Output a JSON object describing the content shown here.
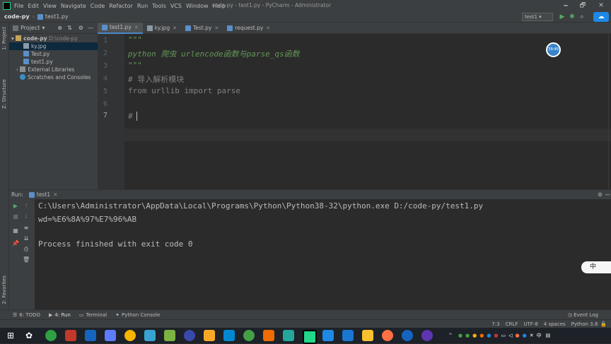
{
  "window": {
    "title": "code-py - test1.py - PyCharm - Administrator",
    "menu": [
      "File",
      "Edit",
      "View",
      "Navigate",
      "Code",
      "Refactor",
      "Run",
      "Tools",
      "VCS",
      "Window",
      "Help"
    ],
    "controls": [
      "🗕",
      "🗗",
      "✕"
    ]
  },
  "navbar": {
    "project": "code-py",
    "file": "test1.py",
    "run_config": "test1"
  },
  "project_panel": {
    "title": "Project",
    "strip_labels": [
      "1: Project",
      "Z: Structure",
      "2: Favorites"
    ],
    "tree": [
      {
        "label": "code-py",
        "path": "D:\\code-py",
        "kind": "folder",
        "indent": 0
      },
      {
        "label": "ky.jpg",
        "kind": "image",
        "indent": 2,
        "selected": true
      },
      {
        "label": "Test.py",
        "kind": "py",
        "indent": 2
      },
      {
        "label": "test1.py",
        "kind": "py",
        "indent": 2
      },
      {
        "label": "External Libraries",
        "kind": "lib",
        "indent": 1
      },
      {
        "label": "Scratches and Consoles",
        "kind": "scratch",
        "indent": 1
      }
    ]
  },
  "editor": {
    "tabs": [
      {
        "label": "test1.py",
        "active": true
      },
      {
        "label": "ky.jpg",
        "active": false
      },
      {
        "label": "Test.py",
        "active": false
      },
      {
        "label": "request.py",
        "active": false
      }
    ],
    "lines": [
      {
        "num": "1",
        "text": "\"\"\""
      },
      {
        "num": "2",
        "text": "python 爬虫 urlencode函数与parse_qs函数"
      },
      {
        "num": "3",
        "text": "\"\"\""
      },
      {
        "num": "4",
        "text": "# 导入解析模块"
      },
      {
        "num": "5",
        "text": "from urllib import parse"
      },
      {
        "num": "6",
        "text": ""
      },
      {
        "num": "7",
        "text": "# "
      }
    ],
    "avatar_text": "39:40"
  },
  "run_panel": {
    "label": "Run:",
    "tab": "test1",
    "output": [
      "C:\\Users\\Administrator\\AppData\\Local\\Programs\\Python\\Python38-32\\python.exe D:/code-py/test1.py",
      "wd=%E6%8A%97%E7%96%AB",
      "",
      "Process finished with exit code 0"
    ]
  },
  "tool_windows": [
    "6: TODO",
    "4: Run",
    "Terminal",
    "Python Console"
  ],
  "event_log": "Event Log",
  "status": {
    "position": "7:3",
    "line_sep": "CRLF",
    "encoding": "UTF-8",
    "indent": "4 spaces",
    "interpreter": "Python 3.8"
  },
  "ime": "中",
  "colors": {
    "keyword": "#cc7832",
    "docstring": "#629755",
    "comment": "#808080",
    "text": "#a9b7c6",
    "accent": "#4a88c7"
  }
}
